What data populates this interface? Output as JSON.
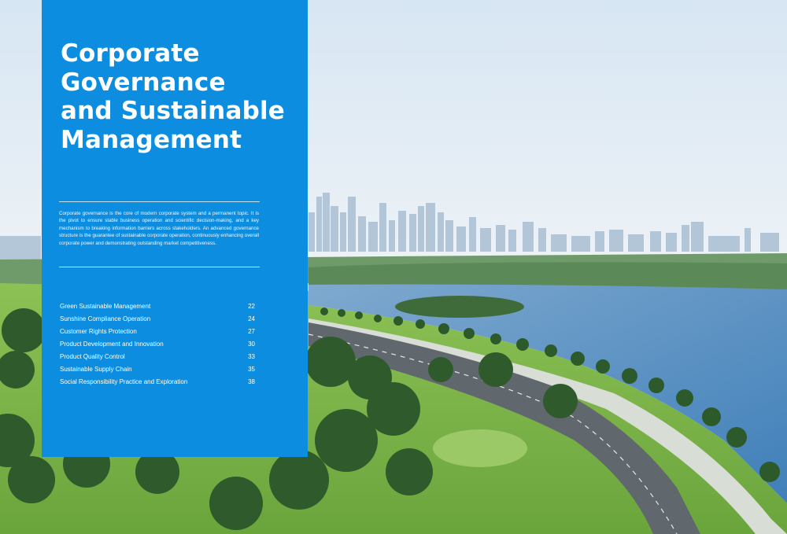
{
  "panel": {
    "title_lines": [
      "Corporate",
      "Governance",
      "and Sustainable",
      "Management"
    ],
    "intro": "Corporate governance is the core of modern corporate system and a permanent topic. It is the pivot to ensure stable business operation and scientific decision-making, and a key mechanism to breaking information barriers across stakeholders. An advanced governance structure is the guarantee of sustainable corporate operation, continuously enhancing overall corporate power and demonstrating outstanding market competitiveness.",
    "toc": [
      {
        "label": "Green Sustainable Management",
        "page": "22"
      },
      {
        "label": "Sunshine Compliance Operation",
        "page": "24"
      },
      {
        "label": "Customer Rights Protection",
        "page": "27"
      },
      {
        "label": "Product Development and Innovation",
        "page": "30"
      },
      {
        "label": "Product Quality Control",
        "page": "33"
      },
      {
        "label": "Sustainable Supply Chain",
        "page": "35"
      },
      {
        "label": "Social Responsibility Practice and Exploration",
        "page": "38"
      }
    ]
  },
  "colors": {
    "panel_blue": "#0d8de0",
    "sky": "#dfeaf4",
    "water": "#4f8fc4",
    "grass": "#7fb84a",
    "trees": "#2f5a2c"
  },
  "image": {
    "subject": "aerial-city-lake-park-photo"
  }
}
